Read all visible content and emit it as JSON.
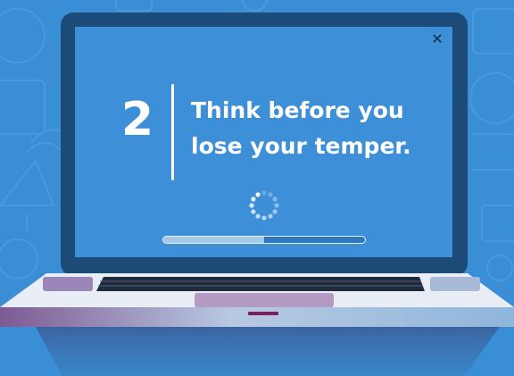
{
  "tip": {
    "number": "2",
    "line1": "Think before you",
    "line2": "lose your temper."
  },
  "progress": {
    "value": 0.5
  },
  "icons": {
    "close": "close-icon",
    "spinner": "loading-spinner-icon"
  },
  "colors": {
    "background": "#3a8ed6",
    "screen": "#3d8fd8",
    "bezel": "#1d4b78",
    "text": "#ffffff"
  }
}
